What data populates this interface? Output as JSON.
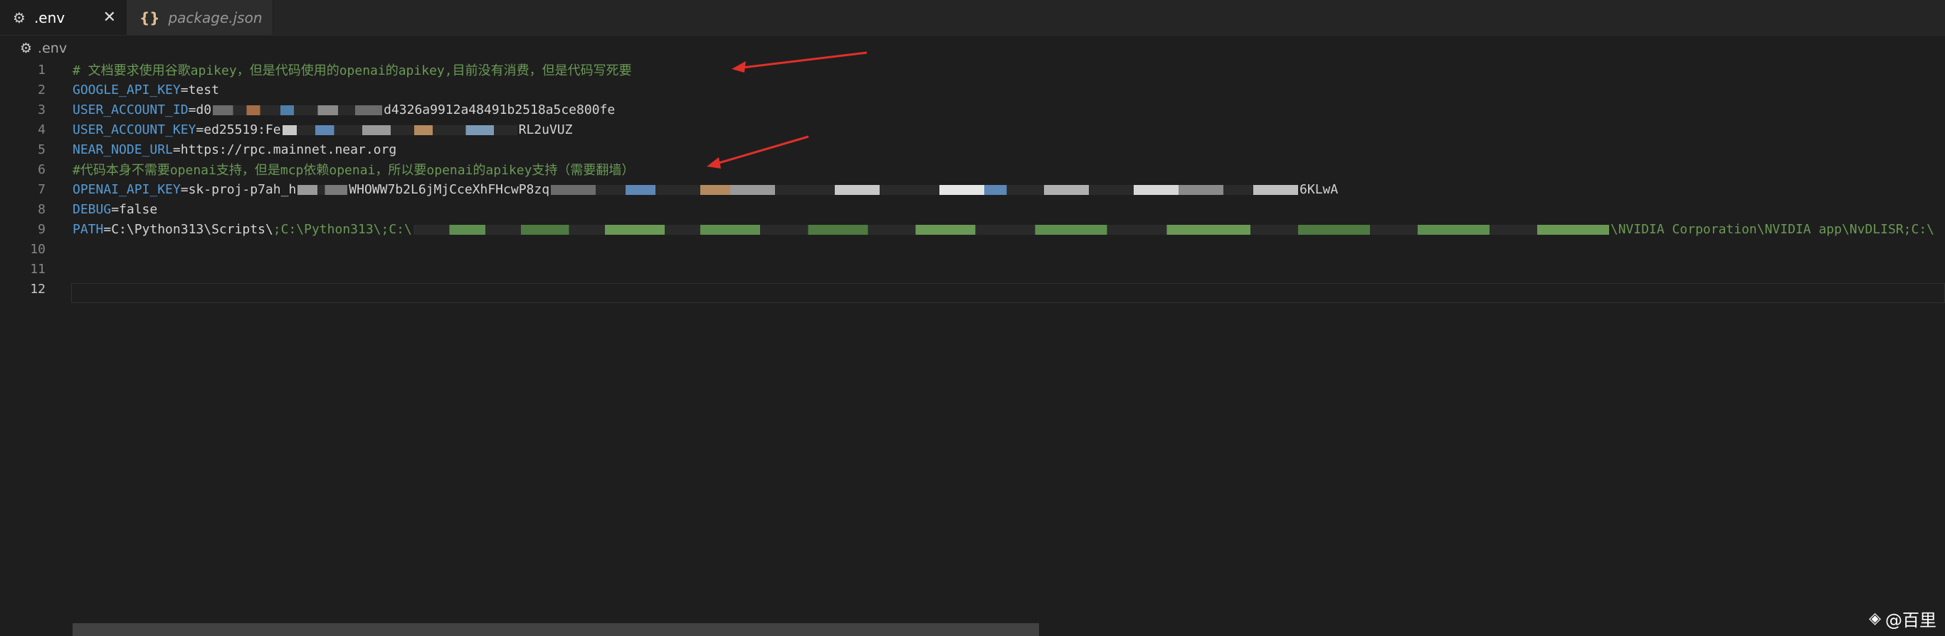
{
  "tabs": [
    {
      "label": ".env",
      "icon": "gear-icon",
      "active": true,
      "close": "✕"
    },
    {
      "label": "package.json",
      "icon": "braces-icon",
      "active": false
    }
  ],
  "breadcrumb": {
    "file": ".env"
  },
  "editor": {
    "lines": [
      {
        "num": "1",
        "comment": "# 文档要求使用谷歌apikey，但是代码使用的openai的apikey,目前没有消费，但是代码写死要"
      },
      {
        "num": "2",
        "key": "GOOGLE_API_KEY",
        "eq": "=",
        "value": "test"
      },
      {
        "num": "3",
        "key": "USER_ACCOUNT_ID",
        "eq": "=",
        "value_start": "d0",
        "value_end": "d4326a9912a48491b2518a5ce800fe"
      },
      {
        "num": "4",
        "key": "USER_ACCOUNT_KEY",
        "eq": "=",
        "value_start": "ed25519:Fe",
        "value_end": "RL2uVUZ"
      },
      {
        "num": "5",
        "key": "NEAR_NODE_URL",
        "eq": "=",
        "value": "https://rpc.mainnet.near.org"
      },
      {
        "num": "6",
        "comment": "#代码本身不需要openai支持，但是mcp依赖openai，所以要openai的apikey支持（需要翻墙）"
      },
      {
        "num": "7",
        "key": "OPENAI_API_KEY",
        "eq": "=",
        "value_start": "sk-proj-p7ah_h",
        "value_mid": "WHOWW7b2L6jMjCceXhFHcwP8zq",
        "value_end": "6KLwA"
      },
      {
        "num": "8",
        "key": "DEBUG",
        "eq": "=",
        "value": "false"
      },
      {
        "num": "9",
        "key": "PATH",
        "eq": "=",
        "value": "C:\\Python313\\Scripts\\",
        "value_dim": ";C:\\Python313\\;C:\\",
        "value_tail": "\\NVIDIA Corporation\\NVIDIA app\\NvDLISR;C:\\"
      },
      {
        "num": "10"
      },
      {
        "num": "11"
      },
      {
        "num": "12",
        "current": true
      }
    ]
  },
  "colors": {
    "keyword": "#569cd6",
    "comment": "#6a9955",
    "arrow": "#e0302a"
  },
  "watermark": {
    "text": "@百里"
  }
}
